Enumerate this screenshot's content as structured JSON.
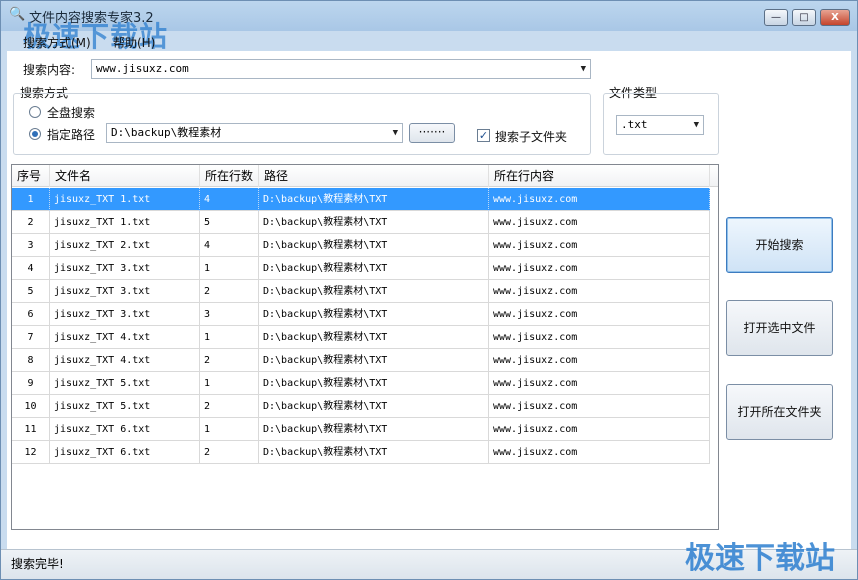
{
  "window": {
    "title": "文件内容搜索专家3.2",
    "watermark": "极速下载站",
    "minimize": "—",
    "maximize": "□",
    "close": "X"
  },
  "menu": [
    "搜索方式(M)",
    "帮助(H)"
  ],
  "search": {
    "content_label": "搜索内容:",
    "content_value": "www.jisuxz.com",
    "mode_group_label": "搜索方式",
    "radio_all_label": "全盘搜索",
    "radio_path_label": "指定路径",
    "path_value": "D:\\backup\\教程素材",
    "browse_label": "·······",
    "subfolder_label": "搜索子文件夹",
    "subfolder_checked": "✓"
  },
  "filetype": {
    "group_label": "文件类型",
    "value": ".txt"
  },
  "table": {
    "headers": [
      "序号",
      "文件名",
      "所在行数",
      "路径",
      "所在行内容"
    ],
    "rows": [
      [
        "1",
        "jisuxz_TXT 1.txt",
        "4",
        "D:\\backup\\教程素材\\TXT",
        "www.jisuxz.com"
      ],
      [
        "2",
        "jisuxz_TXT 1.txt",
        "5",
        "D:\\backup\\教程素材\\TXT",
        "www.jisuxz.com"
      ],
      [
        "3",
        "jisuxz_TXT 2.txt",
        "4",
        "D:\\backup\\教程素材\\TXT",
        "www.jisuxz.com"
      ],
      [
        "4",
        "jisuxz_TXT 3.txt",
        "1",
        "D:\\backup\\教程素材\\TXT",
        "www.jisuxz.com"
      ],
      [
        "5",
        "jisuxz_TXT 3.txt",
        "2",
        "D:\\backup\\教程素材\\TXT",
        "www.jisuxz.com"
      ],
      [
        "6",
        "jisuxz_TXT 3.txt",
        "3",
        "D:\\backup\\教程素材\\TXT",
        "www.jisuxz.com"
      ],
      [
        "7",
        "jisuxz_TXT 4.txt",
        "1",
        "D:\\backup\\教程素材\\TXT",
        "www.jisuxz.com"
      ],
      [
        "8",
        "jisuxz_TXT 4.txt",
        "2",
        "D:\\backup\\教程素材\\TXT",
        "www.jisuxz.com"
      ],
      [
        "9",
        "jisuxz_TXT 5.txt",
        "1",
        "D:\\backup\\教程素材\\TXT",
        "www.jisuxz.com"
      ],
      [
        "10",
        "jisuxz_TXT 5.txt",
        "2",
        "D:\\backup\\教程素材\\TXT",
        "www.jisuxz.com"
      ],
      [
        "11",
        "jisuxz_TXT 6.txt",
        "1",
        "D:\\backup\\教程素材\\TXT",
        "www.jisuxz.com"
      ],
      [
        "12",
        "jisuxz_TXT 6.txt",
        "2",
        "D:\\backup\\教程素材\\TXT",
        "www.jisuxz.com"
      ]
    ]
  },
  "actions": {
    "start_search": "开始搜索",
    "open_file": "打开选中文件",
    "open_folder": "打开所在文件夹"
  },
  "status": {
    "text": "搜索完毕!"
  },
  "colors": {
    "selected_row": "#3399ff",
    "watermark": "#2d7fd0"
  }
}
